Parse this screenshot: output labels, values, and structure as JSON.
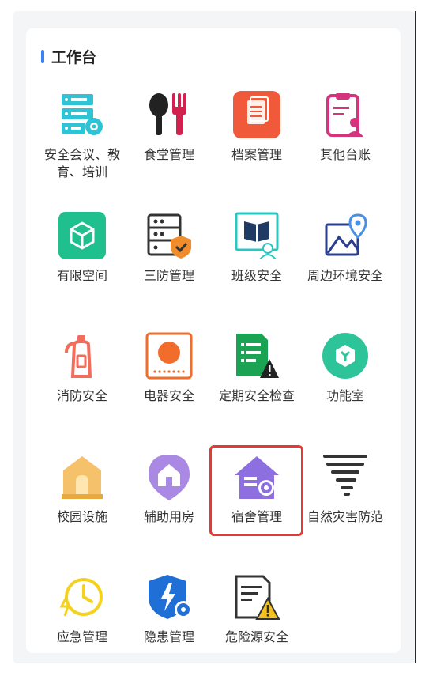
{
  "section": {
    "title": "工作台",
    "accent": "#3b82f6"
  },
  "items": [
    {
      "label": "安全会议、教育、培训",
      "icon": "server-gear-icon"
    },
    {
      "label": "食堂管理",
      "icon": "spoon-fork-icon"
    },
    {
      "label": "档案管理",
      "icon": "document-folder-icon"
    },
    {
      "label": "其他台账",
      "icon": "clipboard-user-icon"
    },
    {
      "label": "有限空间",
      "icon": "cube-icon"
    },
    {
      "label": "三防管理",
      "icon": "cabinet-shield-icon"
    },
    {
      "label": "班级安全",
      "icon": "book-student-icon"
    },
    {
      "label": "周边环境安全",
      "icon": "map-pin-icon"
    },
    {
      "label": "消防安全",
      "icon": "fire-extinguisher-icon"
    },
    {
      "label": "电器安全",
      "icon": "appliance-icon"
    },
    {
      "label": "定期安全检查",
      "icon": "checklist-warning-icon"
    },
    {
      "label": "功能室",
      "icon": "hexagon-room-icon"
    },
    {
      "label": "校园设施",
      "icon": "gate-icon"
    },
    {
      "label": "辅助用房",
      "icon": "house-pin-icon"
    },
    {
      "label": "宿舍管理",
      "icon": "house-gear-icon"
    },
    {
      "label": "自然灾害防范",
      "icon": "tornado-icon"
    },
    {
      "label": "应急管理",
      "icon": "clock-lightning-icon"
    },
    {
      "label": "隐患管理",
      "icon": "shield-bolt-icon"
    },
    {
      "label": "危险源安全",
      "icon": "document-warning-icon"
    }
  ],
  "highlighted_item": "宿舍管理",
  "highlight_color": "#e53935"
}
